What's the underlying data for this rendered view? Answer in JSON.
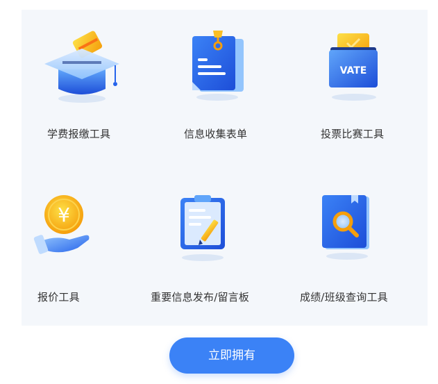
{
  "tools": [
    {
      "label": "学费报缴工具",
      "icon": "graduation-cap-card-icon"
    },
    {
      "label": "信息收集表单",
      "icon": "form-document-icon"
    },
    {
      "label": "投票比赛工具",
      "icon": "vote-box-icon",
      "icon_text": "VATE"
    },
    {
      "label": "报价工具",
      "icon": "yuan-coin-hand-icon",
      "icon_text": "¥"
    },
    {
      "label": "重要信息发布/留言板",
      "icon": "clipboard-pen-icon"
    },
    {
      "label": "成绩/班级查询工具",
      "icon": "book-search-icon"
    }
  ],
  "cta": {
    "label": "立即拥有"
  },
  "colors": {
    "accent": "#3b82f6",
    "panel_bg": "#f4f7fb",
    "gold": "#fbbf24",
    "text": "#333333"
  }
}
